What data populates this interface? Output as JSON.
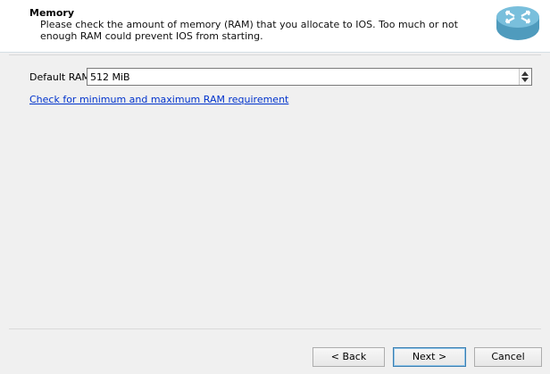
{
  "header": {
    "title": "Memory",
    "subtitle": "Please check the amount of memory (RAM) that you allocate to IOS. Too much or not enough RAM could prevent IOS from starting."
  },
  "form": {
    "ram_label": "Default RAM:",
    "ram_value": "512 MiB",
    "check_link": "Check for minimum and maximum RAM requirement"
  },
  "buttons": {
    "back": "< Back",
    "next": "Next >",
    "cancel": "Cancel"
  },
  "icons": {
    "logo": "router-icon"
  },
  "colors": {
    "link": "#0033cc",
    "logo": "#5aa7c8"
  }
}
